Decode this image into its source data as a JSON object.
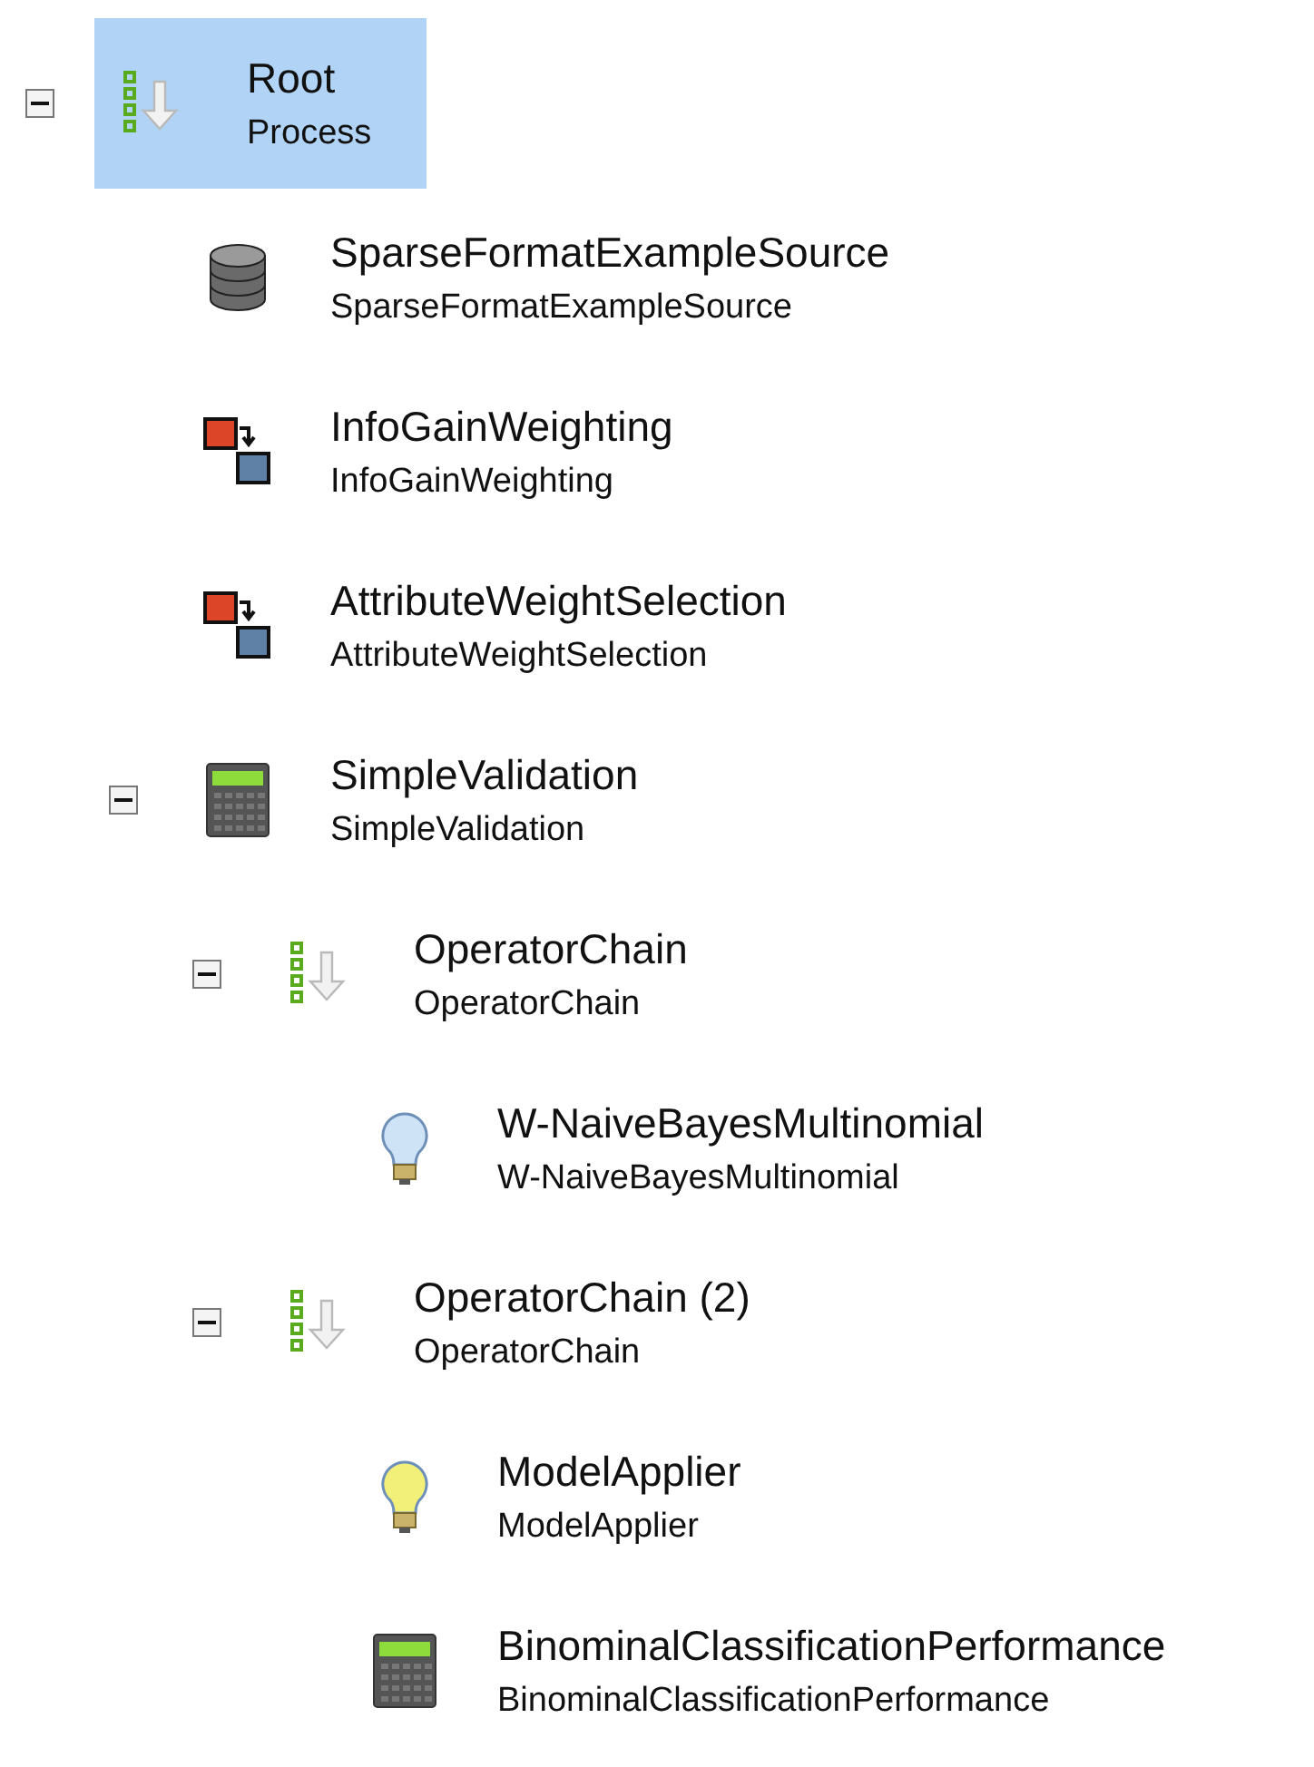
{
  "tree": {
    "nodes": [
      {
        "title": "Root",
        "subtitle": "Process",
        "kind": "chain",
        "selected": true,
        "expanded": true,
        "children": [
          {
            "title": "SparseFormatExampleSource",
            "subtitle": "SparseFormatExampleSource",
            "kind": "source",
            "selected": false
          },
          {
            "title": "InfoGainWeighting",
            "subtitle": "InfoGainWeighting",
            "kind": "weighting",
            "selected": false
          },
          {
            "title": "AttributeWeightSelection",
            "subtitle": "AttributeWeightSelection",
            "kind": "weighting",
            "selected": false
          },
          {
            "title": "SimpleValidation",
            "subtitle": "SimpleValidation",
            "kind": "validation",
            "selected": false,
            "expanded": true,
            "children": [
              {
                "title": "OperatorChain",
                "subtitle": "OperatorChain",
                "kind": "chain",
                "selected": false,
                "expanded": true,
                "children": [
                  {
                    "title": "W-NaiveBayesMultinomial",
                    "subtitle": "W-NaiveBayesMultinomial",
                    "kind": "learner",
                    "selected": false
                  }
                ]
              },
              {
                "title": "OperatorChain (2)",
                "subtitle": "OperatorChain",
                "kind": "chain",
                "selected": false,
                "expanded": true,
                "children": [
                  {
                    "title": "ModelApplier",
                    "subtitle": "ModelApplier",
                    "kind": "applier",
                    "selected": false
                  },
                  {
                    "title": "BinominalClassificationPerformance",
                    "subtitle": "BinominalClassificationPerformance",
                    "kind": "validation",
                    "selected": false
                  }
                ]
              }
            ]
          }
        ]
      }
    ]
  }
}
